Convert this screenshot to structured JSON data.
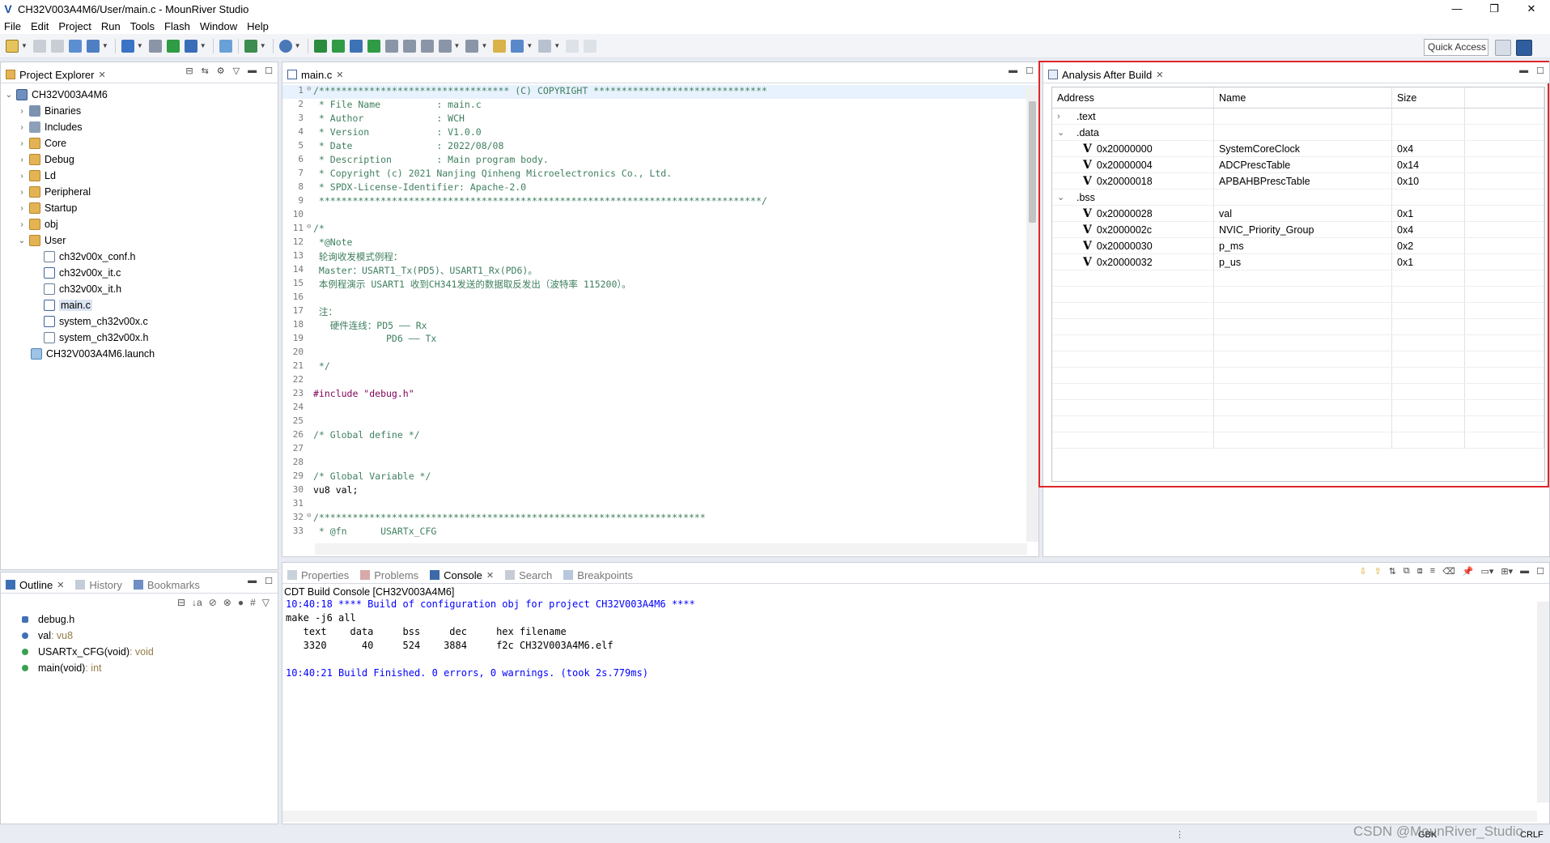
{
  "window": {
    "title": "CH32V003A4M6/User/main.c - MounRiver Studio",
    "controls": [
      "—",
      "❐",
      "✕"
    ]
  },
  "menu": [
    "File",
    "Edit",
    "Project",
    "Run",
    "Tools",
    "Flash",
    "Window",
    "Help"
  ],
  "toolbar": {
    "quick_access": "Quick Access"
  },
  "project_explorer": {
    "tab_label": "Project Explorer",
    "root": "CH32V003A4M6",
    "items": [
      {
        "label": "Binaries",
        "type": "binaries"
      },
      {
        "label": "Includes",
        "type": "includes"
      },
      {
        "label": "Core",
        "type": "folder"
      },
      {
        "label": "Debug",
        "type": "folder"
      },
      {
        "label": "Ld",
        "type": "folder"
      },
      {
        "label": "Peripheral",
        "type": "folder"
      },
      {
        "label": "Startup",
        "type": "folder"
      },
      {
        "label": "obj",
        "type": "folder"
      },
      {
        "label": "User",
        "type": "folder-open"
      }
    ],
    "user_files": [
      "ch32v00x_conf.h",
      "ch32v00x_it.c",
      "ch32v00x_it.h",
      "main.c",
      "system_ch32v00x.c",
      "system_ch32v00x.h"
    ],
    "launch_file": "CH32V003A4M6.launch"
  },
  "editor": {
    "tab_label": "main.c",
    "lines": [
      {
        "n": "1",
        "fold": "⊖",
        "text": "/********************************** (C) COPYRIGHT *******************************",
        "cls": "ctext"
      },
      {
        "n": "2",
        "fold": "",
        "text": " * File Name          : main.c",
        "cls": "ctext"
      },
      {
        "n": "3",
        "fold": "",
        "text": " * Author             : WCH",
        "cls": "ctext"
      },
      {
        "n": "4",
        "fold": "",
        "text": " * Version            : V1.0.0",
        "cls": "ctext"
      },
      {
        "n": "5",
        "fold": "",
        "text": " * Date               : 2022/08/08",
        "cls": "ctext"
      },
      {
        "n": "6",
        "fold": "",
        "text": " * Description        : Main program body.",
        "cls": "ctext"
      },
      {
        "n": "7",
        "fold": "",
        "text": " * Copyright (c) 2021 Nanjing Qinheng Microelectronics Co., Ltd.",
        "cls": "ctext"
      },
      {
        "n": "8",
        "fold": "",
        "text": " * SPDX-License-Identifier: Apache-2.0",
        "cls": "ctext"
      },
      {
        "n": "9",
        "fold": "",
        "text": " *******************************************************************************/",
        "cls": "ctext"
      },
      {
        "n": "10",
        "fold": "",
        "text": "",
        "cls": ""
      },
      {
        "n": "11",
        "fold": "⊖",
        "text": "/*",
        "cls": "ctext"
      },
      {
        "n": "12",
        "fold": "",
        "text": " *@Note",
        "cls": "ctext"
      },
      {
        "n": "13",
        "fold": "",
        "text": " 轮询收发模式例程：",
        "cls": "ctext"
      },
      {
        "n": "14",
        "fold": "",
        "text": " Master：USART1_Tx(PD5)、USART1_Rx(PD6)。",
        "cls": "ctext"
      },
      {
        "n": "15",
        "fold": "",
        "text": " 本例程演示 USART1 收到CH341发送的数据取反发出（波特率 115200）。",
        "cls": "ctext"
      },
      {
        "n": "16",
        "fold": "",
        "text": "",
        "cls": ""
      },
      {
        "n": "17",
        "fold": "",
        "text": " 注：",
        "cls": "ctext"
      },
      {
        "n": "18",
        "fold": "",
        "text": "   硬件连线：PD5 —— Rx",
        "cls": "ctext"
      },
      {
        "n": "19",
        "fold": "",
        "text": "             PD6 —— Tx",
        "cls": "ctext"
      },
      {
        "n": "20",
        "fold": "",
        "text": "",
        "cls": ""
      },
      {
        "n": "21",
        "fold": "",
        "text": " */",
        "cls": "ctext"
      },
      {
        "n": "22",
        "fold": "",
        "text": "",
        "cls": ""
      },
      {
        "n": "23",
        "fold": "",
        "text": "#include \"debug.h\"",
        "cls": "include"
      },
      {
        "n": "24",
        "fold": "",
        "text": "",
        "cls": ""
      },
      {
        "n": "25",
        "fold": "",
        "text": "",
        "cls": ""
      },
      {
        "n": "26",
        "fold": "",
        "text": "/* Global define */",
        "cls": "ctext"
      },
      {
        "n": "27",
        "fold": "",
        "text": "",
        "cls": ""
      },
      {
        "n": "28",
        "fold": "",
        "text": "",
        "cls": ""
      },
      {
        "n": "29",
        "fold": "",
        "text": "/* Global Variable */",
        "cls": "ctext"
      },
      {
        "n": "30",
        "fold": "",
        "text": "vu8 val;",
        "cls": ""
      },
      {
        "n": "31",
        "fold": "",
        "text": "",
        "cls": ""
      },
      {
        "n": "32",
        "fold": "⊖",
        "text": "/*********************************************************************",
        "cls": "ctext"
      },
      {
        "n": "33",
        "fold": "",
        "text": " * @fn      USARTx_CFG",
        "cls": "ctext"
      }
    ]
  },
  "analysis": {
    "tab_label": "Analysis After Build",
    "headers": [
      "Address",
      "Name",
      "Size"
    ],
    "sections": [
      {
        "label": ".text",
        "expanded": false,
        "rows": []
      },
      {
        "label": ".data",
        "expanded": true,
        "rows": [
          {
            "address": "0x20000000",
            "name": "SystemCoreClock",
            "size": "0x4"
          },
          {
            "address": "0x20000004",
            "name": "ADCPrescTable",
            "size": "0x14"
          },
          {
            "address": "0x20000018",
            "name": "APBAHBPrescTable",
            "size": "0x10"
          }
        ]
      },
      {
        "label": ".bss",
        "expanded": true,
        "rows": [
          {
            "address": "0x20000028",
            "name": "val",
            "size": "0x1"
          },
          {
            "address": "0x2000002c",
            "name": "NVIC_Priority_Group",
            "size": "0x4"
          },
          {
            "address": "0x20000030",
            "name": "p_ms",
            "size": "0x2"
          },
          {
            "address": "0x20000032",
            "name": "p_us",
            "size": "0x1"
          }
        ]
      }
    ],
    "highlight_color": "#e0262a"
  },
  "outline": {
    "tabs": [
      "Outline",
      "History",
      "Bookmarks"
    ],
    "items": [
      {
        "label": "debug.h",
        "type": ""
      },
      {
        "label": "val",
        "type": " : vu8"
      },
      {
        "label": "USARTx_CFG(void)",
        "type": " : void"
      },
      {
        "label": "main(void)",
        "type": " : int"
      }
    ]
  },
  "bottom": {
    "tabs": [
      "Properties",
      "Problems",
      "Console",
      "Search",
      "Breakpoints"
    ],
    "console_title": "CDT Build Console [CH32V003A4M6]",
    "lines": [
      {
        "text": "10:40:18 **** Build of configuration obj for project CH32V003A4M6 ****",
        "color": "blue"
      },
      {
        "text": "make -j6 all",
        "color": "black"
      },
      {
        "text": "   text    data     bss     dec     hex filename",
        "color": "black"
      },
      {
        "text": "   3320      40     524    3884     f2c CH32V003A4M6.elf",
        "color": "black"
      },
      {
        "text": "",
        "color": "black"
      },
      {
        "text": "10:40:21 Build Finished. 0 errors, 0 warnings. (took 2s.779ms)",
        "color": "blue"
      }
    ]
  },
  "status": {
    "encoding": "GBK",
    "line_ending": "CRLF",
    "watermark": "CSDN @MounRiver_Studio"
  }
}
